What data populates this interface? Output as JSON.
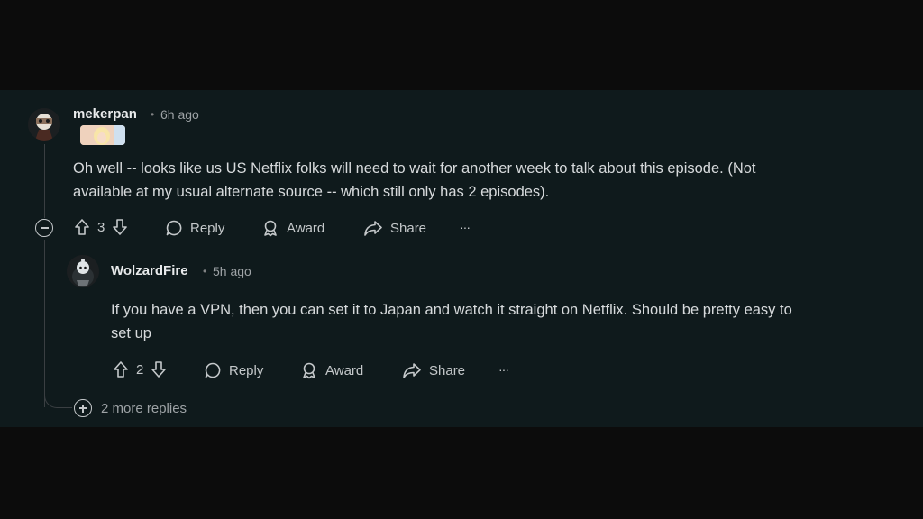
{
  "comments": [
    {
      "username": "mekerpan",
      "separator": "•",
      "time": "6h ago",
      "text_line1": "Oh well -- looks like us US Netflix folks will need to wait for another week to talk about this episode. (Not",
      "text_line2": "available at my usual alternate source -- which still only has 2 episodes).",
      "votes": "3",
      "reply_label": "Reply",
      "award_label": "Award",
      "share_label": "Share",
      "more_label": "···"
    },
    {
      "username": "WolzardFire",
      "separator": "•",
      "time": "5h ago",
      "text_line1": "If you have a VPN, then you can set it to Japan and watch it straight on Netflix. Should be pretty easy to",
      "text_line2": "set up",
      "votes": "2",
      "reply_label": "Reply",
      "award_label": "Award",
      "share_label": "Share",
      "more_label": "···"
    }
  ],
  "more_replies_label": "2 more replies",
  "icons": {
    "upvote": "arrow-up-icon",
    "downvote": "arrow-down-icon",
    "reply": "speech-bubble-icon",
    "award": "award-ribbon-icon",
    "share": "share-arrow-icon",
    "collapse": "minus-circle-icon",
    "expand": "plus-circle-icon"
  },
  "colors": {
    "panel_bg": "#0f1a1c",
    "page_bg": "#0c0c0c",
    "text": "#d7dadc",
    "muted": "#9ea3a6"
  }
}
